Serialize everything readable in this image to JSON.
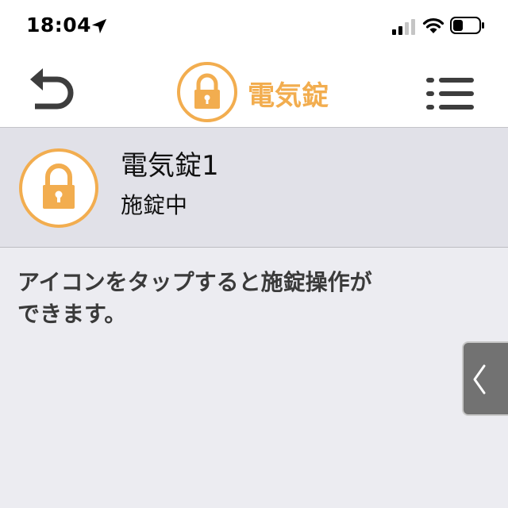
{
  "status_bar": {
    "time": "18:04",
    "icons": [
      "location-arrow-icon",
      "cellular-signal-icon",
      "wifi-icon",
      "battery-icon"
    ]
  },
  "nav": {
    "title": "電気錠",
    "back_icon": "back-arrow-icon",
    "title_icon": "lock-icon",
    "menu_icon": "list-menu-icon"
  },
  "device": {
    "name": "電気錠1",
    "status": "施錠中",
    "icon": "lock-icon"
  },
  "hint": {
    "line1": "アイコンをタップすると施錠操作が",
    "line2": "できます。"
  },
  "side_tab": {
    "icon": "chevron-left-icon"
  },
  "colors": {
    "accent": "#f2ad4f",
    "row_background": "#e1e1e8",
    "page_background": "#ececf1",
    "icon_gray": "#3d3d3d"
  }
}
